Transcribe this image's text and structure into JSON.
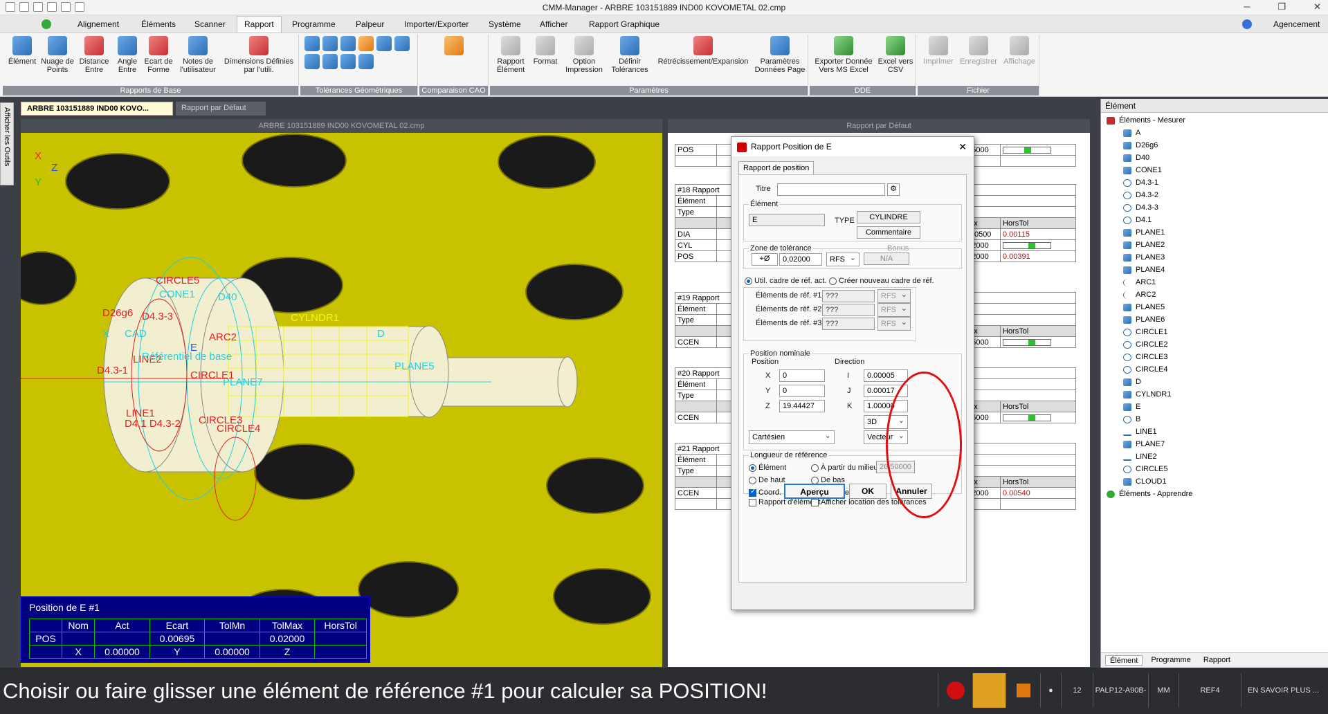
{
  "app": {
    "title": "CMM-Manager - ARBRE 103151889 IND00 KOVOMETAL 02.cmp",
    "win_min": "─",
    "win_max": "❐",
    "win_close": "✕"
  },
  "menu": {
    "items": [
      "Alignement",
      "Éléments",
      "Scanner",
      "Rapport",
      "Programme",
      "Palpeur",
      "Importer/Exporter",
      "Système",
      "Afficher",
      "Rapport Graphique"
    ],
    "active": "Rapport",
    "right_label": "Agencement"
  },
  "ribbon": {
    "groups": [
      {
        "label": "Rapports de Base",
        "buttons": [
          "Élément",
          "Nuage de Points",
          "Distance Entre",
          "Angle Entre",
          "Ecart de Forme",
          "Notes de l'utilisateur",
          "Dimensions Définies par l'utili."
        ]
      },
      {
        "label": "Tolérances Géométriques"
      },
      {
        "label": "Comparaison CAO"
      },
      {
        "label": "Paramètres",
        "buttons": [
          "Rapport Élément",
          "Format",
          "Option Impression",
          "Définir Tolérances",
          "Rétrécissement/Expansion",
          "Paramètres Données Page"
        ]
      },
      {
        "label": "DDE",
        "buttons": [
          "Exporter Donnée Vers MS Excel",
          "Excel vers CSV"
        ]
      },
      {
        "label": "Fichier",
        "buttons": [
          "Imprimer",
          "Enregistrer",
          "Affichage"
        ]
      }
    ]
  },
  "tabs": {
    "doc1": "ARBRE 103151889 IND00 KOVO...",
    "doc2": "Rapport par Défaut",
    "side": "Afficher les Outils"
  },
  "viewport": {
    "title": "ARBRE 103151889 IND00 KOVOMETAL 02.cmp",
    "labels": [
      "CIRCLE5",
      "CONE1",
      "D40",
      "D26g6",
      "D4.3-3",
      "CAD",
      "ARC2",
      "CYLNDR1",
      "D",
      "LINE2",
      "D4.3-1",
      "CIRCLE1",
      "PLANE5",
      "LINE1",
      "D4.1 D4.3-2",
      "CIRCLE3",
      "CIRCLE4",
      "PLANE7",
      "Référentiel de base",
      "X",
      "E"
    ],
    "axis_x": "X",
    "axis_z": "Z",
    "axis_y": "Y"
  },
  "posbox": {
    "title": "Position de E #1",
    "header": [
      "",
      "Nom",
      "Act",
      "Ecart",
      "TolMn",
      "TolMax",
      "HorsTol"
    ],
    "row1": [
      "POS",
      "",
      "",
      "0.00695",
      "",
      "0.02000",
      ""
    ],
    "row2": [
      "",
      "X",
      "0.00000",
      "Y",
      "0.00000",
      "Z",
      ""
    ]
  },
  "report": {
    "title": "Rapport par Défaut",
    "blocks": [
      {
        "hdr": "",
        "rows": [
          [
            "POS",
            "",
            "0.05000"
          ]
        ]
      },
      {
        "hdr": "#18 Rapport",
        "rows": [
          [
            "Élément",
            ""
          ],
          [
            "Type",
            ""
          ],
          [
            "",
            "IMax",
            "HorsTol"
          ],
          [
            "DIA",
            "-0.00500",
            "0.00115"
          ],
          [
            "CYL",
            "0.02000",
            ""
          ],
          [
            "POS",
            "0.02000",
            "0.00391"
          ]
        ]
      },
      {
        "hdr": "#19 Rapport",
        "rows": [
          [
            "Élément",
            ""
          ],
          [
            "Type",
            ""
          ],
          [
            "",
            "IMax",
            "HorsTol"
          ],
          [
            "CCEN",
            "0.05000",
            ""
          ]
        ]
      },
      {
        "hdr": "#20 Rapport",
        "rows": [
          [
            "Élément",
            ""
          ],
          [
            "Type",
            ""
          ],
          [
            "",
            "IMax",
            "HorsTol"
          ],
          [
            "CCEN",
            "0.05000",
            ""
          ]
        ]
      },
      {
        "hdr": "#21 Rapport",
        "rows": [
          [
            "Élément",
            ""
          ],
          [
            "Type",
            ""
          ],
          [
            "",
            "IMax",
            "HorsTol"
          ],
          [
            "CCEN",
            "0.02000",
            "0.00540"
          ]
        ]
      }
    ]
  },
  "dialog": {
    "title": "Rapport Position de E",
    "tab": "Rapport de position",
    "titre_label": "Titre",
    "titre_value": "",
    "element_group": "Élément",
    "element_value": "E",
    "type_label": "TYPE",
    "type_value": "CYLINDRE",
    "comment_btn": "Commentaire",
    "zone_group": "Zone de tolérance",
    "bonus_label": "Bonus",
    "tol_value": "0.02000",
    "rfs": "RFS",
    "bonus_value": "N/A",
    "radio_util": "Util. cadre de réf. act.",
    "radio_new": "Créer nouveau cadre de réf.",
    "ref1": "Éléments de réf. #1",
    "ref2": "Éléments de réf. #2",
    "ref3": "Éléments de réf. #3",
    "ref_val": "???",
    "ref_rfs": "RFS",
    "pos_group": "Position nominale",
    "position": "Position",
    "direction": "Direction",
    "x_label": "X",
    "y_label": "Y",
    "z_label": "Z",
    "x": "0",
    "y": "0",
    "z": "19.44427",
    "i_label": "I",
    "j_label": "J",
    "k_label": "K",
    "i": "0.00005",
    "j": "0.00017",
    "k": "1.00000",
    "dim": "3D",
    "coord": "Cartésien",
    "vec": "Vecteur",
    "len_group": "Longueur de référence",
    "r_elem": "Élément",
    "r_mid": "À partir du milieu",
    "mid_value": "26.50000",
    "r_top": "De haut",
    "r_bot": "De bas",
    "c_coord": "Coord.",
    "c_ecart": "Ecart de coord.",
    "c_rapport": "Rapport d'élément",
    "c_loc": "Afficher location des tolérances",
    "btn_apercu": "Aperçu",
    "btn_ok": "OK",
    "btn_annuler": "Annuler"
  },
  "tree": {
    "header": "Élément",
    "root1": "Éléments - Mesurer",
    "items": [
      "A",
      "D26g6",
      "D40",
      "CONE1",
      "D4.3-1",
      "D4.3-2",
      "D4.3-3",
      "D4.1",
      "PLANE1",
      "PLANE2",
      "PLANE3",
      "PLANE4",
      "ARC1",
      "ARC2",
      "PLANE5",
      "PLANE6",
      "CIRCLE1",
      "CIRCLE2",
      "CIRCLE3",
      "CIRCLE4",
      "D",
      "CYLNDR1",
      "E",
      "B",
      "LINE1",
      "PLANE7",
      "LINE2",
      "CIRCLE5",
      "CLOUD1"
    ],
    "root2": "Éléments - Apprendre",
    "bottom_tabs": [
      "Élément",
      "Programme",
      "Rapport"
    ]
  },
  "status": {
    "message": "Choisir ou faire glisser une élément de référence #1 pour calculer sa POSITION!",
    "count": "12",
    "probe": "PALP12-A90B-",
    "unit": "MM",
    "ref": "REF4",
    "more": "EN SAVOIR PLUS ..."
  },
  "colors": {
    "accent": "#2878d8",
    "viewport_bg": "#c9c200",
    "error": "#d00000",
    "highlight": "#e01010"
  }
}
